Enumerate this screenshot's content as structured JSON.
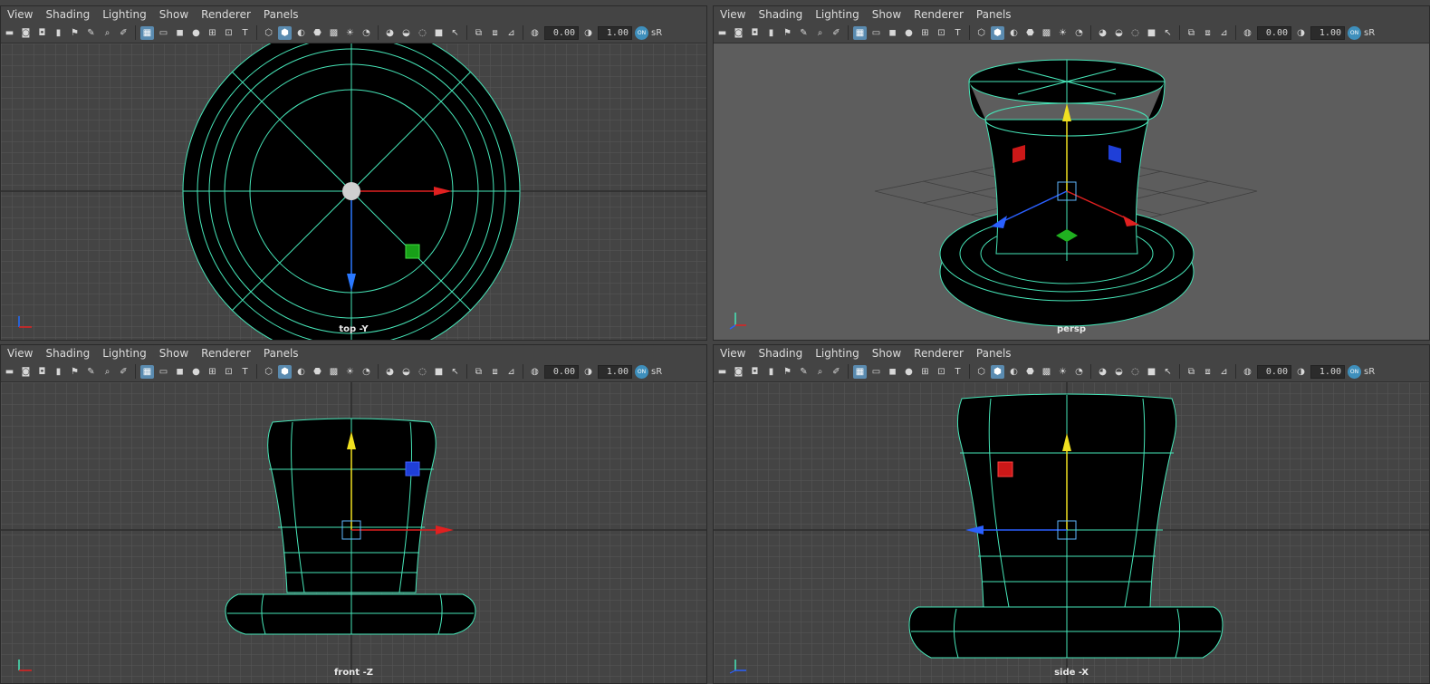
{
  "menu": [
    "View",
    "Shading",
    "Lighting",
    "Show",
    "Renderer",
    "Panels"
  ],
  "toolbar": {
    "field_a": "0.00",
    "field_b": "1.00",
    "color_space": "sR"
  },
  "panels": [
    {
      "id": "top",
      "label": "top -Y"
    },
    {
      "id": "persp",
      "label": "persp"
    },
    {
      "id": "front",
      "label": "front -Z"
    },
    {
      "id": "side",
      "label": "side -X"
    }
  ],
  "axis": {
    "x": "x",
    "y": "y",
    "z": "z"
  },
  "colors": {
    "wire": "#46e6b8",
    "grid": "#5a5a5a",
    "grid_major": "#303030",
    "x_axis": "#e02020",
    "y_axis": "#f0e020",
    "z_axis": "#2060f0",
    "mesh": "#000000"
  }
}
